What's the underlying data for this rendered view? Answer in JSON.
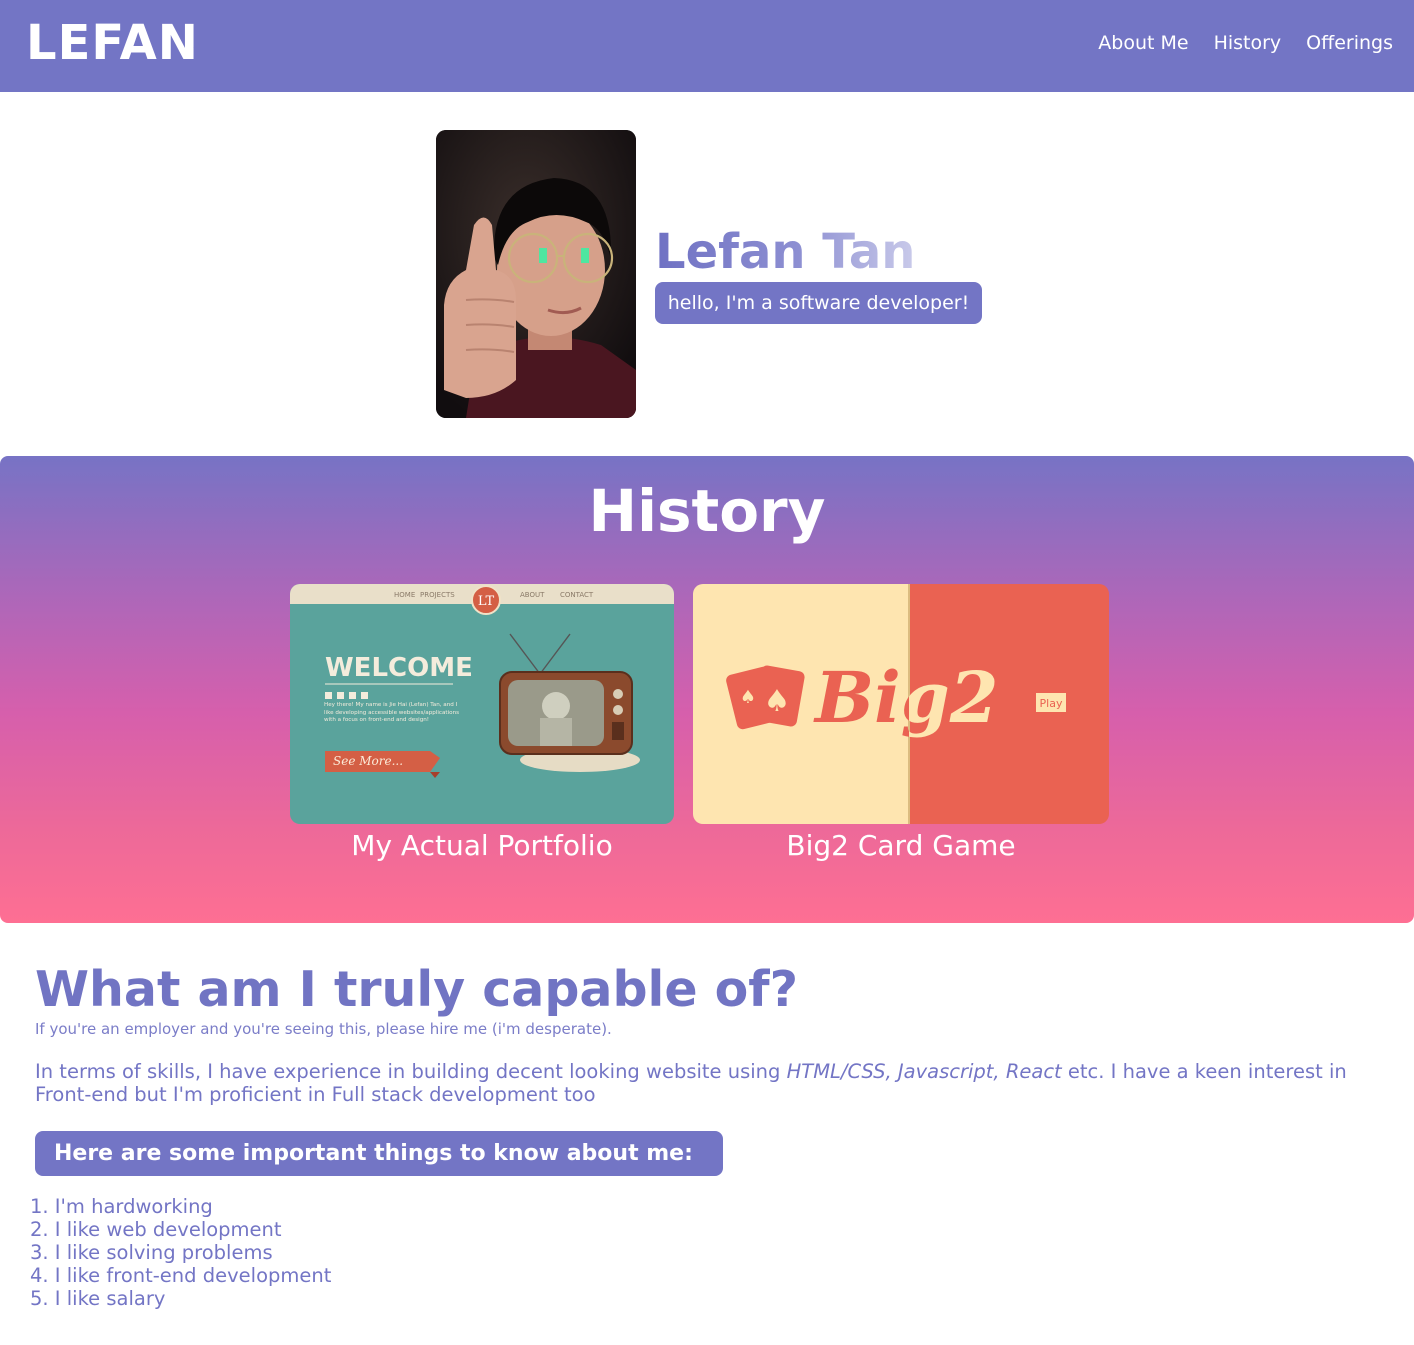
{
  "header": {
    "logo": "LEFAN",
    "nav": [
      {
        "label": "About Me"
      },
      {
        "label": "History"
      },
      {
        "label": "Offerings"
      }
    ]
  },
  "hero": {
    "name": "Lefan Tan",
    "tagline": "hello, I'm a software developer!"
  },
  "history": {
    "title": "History",
    "projects": [
      {
        "caption": "My Actual Portfolio",
        "screenshot": {
          "nav": [
            "HOME",
            "PROJECTS",
            "ABOUT",
            "CONTACT"
          ],
          "logo": "LT",
          "heading": "WELCOME",
          "intro": "Hey there! My name is Jie Hai (Lefan) Tan, and I like developing accessible websites/applications with a focus on front-end and design!",
          "button": "See More..."
        }
      },
      {
        "caption": "Big2 Card Game",
        "screenshot": {
          "logo_text": "Big2",
          "play_label": "Play"
        }
      }
    ]
  },
  "about": {
    "title": "What am I truly capable of?",
    "subtitle": "If you're an employer and you're seeing this, please hire me (i'm desperate).",
    "para_before": "In terms of skills, I have experience in building decent looking website using ",
    "para_skills": "HTML/CSS, Javascript, React",
    "para_after": " etc. I have a keen interest in Front-end but I'm proficient in Full stack development too",
    "pill": "Here are some important things to know about me:",
    "list": [
      "1. I'm hardworking",
      "2. I like web development",
      "3. I like solving problems",
      "4. I like front-end development",
      "5. I like salary"
    ]
  },
  "colors": {
    "brand": "#7375c5",
    "gradient_top": "#7773c5",
    "gradient_bottom": "#fe6f93",
    "big2_cream": "#fee5b0",
    "big2_red": "#ea6252",
    "portfolio_teal": "#5aa39c"
  }
}
